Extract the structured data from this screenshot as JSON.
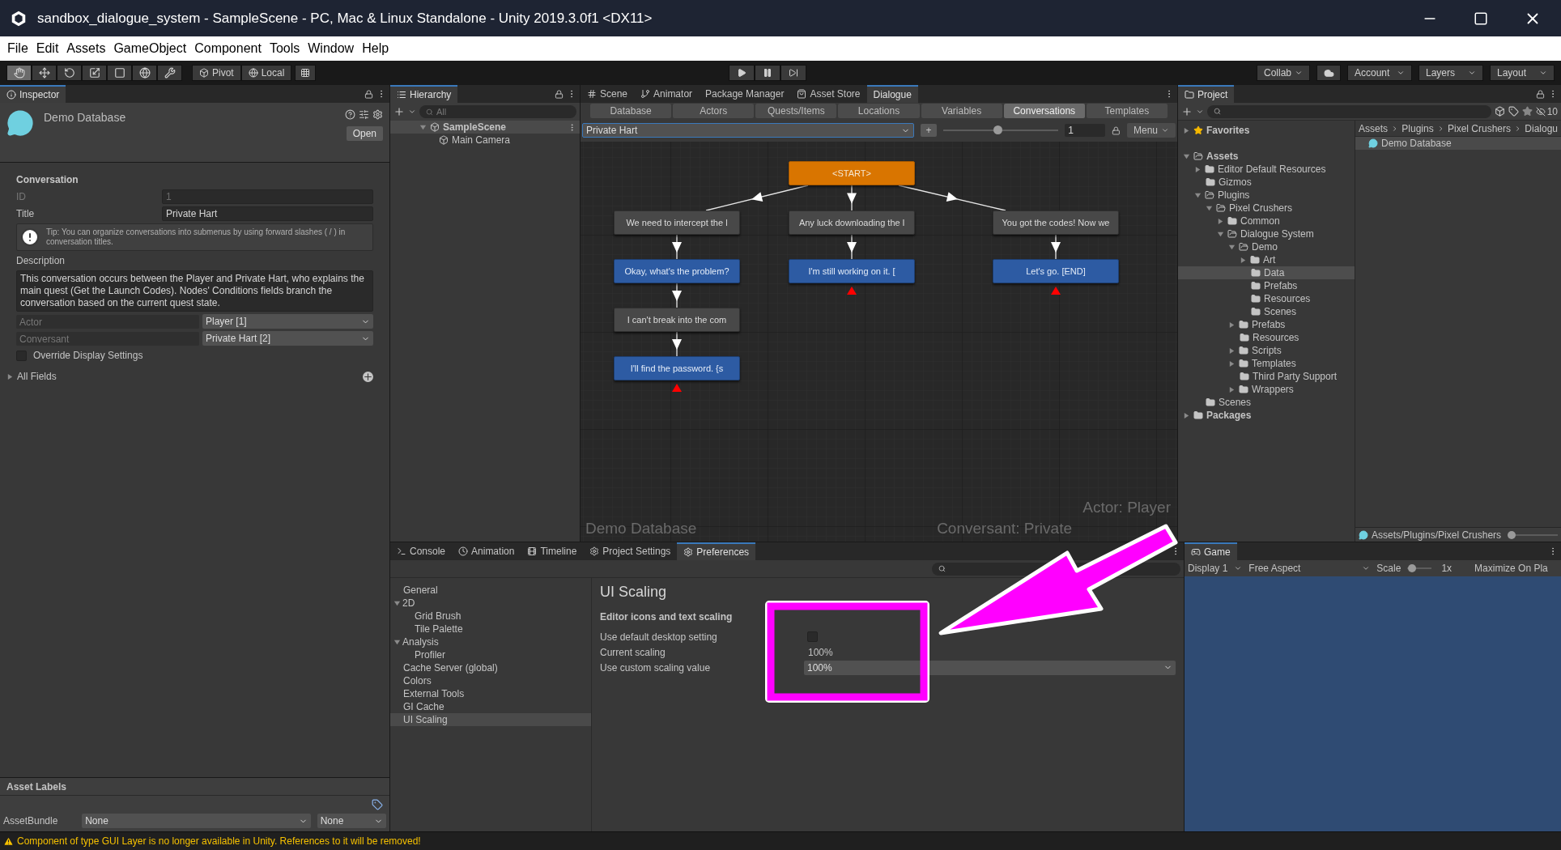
{
  "window": {
    "title": "sandbox_dialogue_system - SampleScene - PC, Mac & Linux Standalone - Unity 2019.3.0f1 <DX11>"
  },
  "menu": [
    "File",
    "Edit",
    "Assets",
    "GameObject",
    "Component",
    "Tools",
    "Window",
    "Help"
  ],
  "toolbar": {
    "tools": [
      {
        "kind": "hand",
        "selected": true
      },
      {
        "kind": "move",
        "selected": false
      },
      {
        "kind": "rotate",
        "selected": false
      },
      {
        "kind": "scale",
        "selected": false
      },
      {
        "kind": "rect",
        "selected": false
      },
      {
        "kind": "transform",
        "selected": false
      },
      {
        "kind": "custom",
        "selected": false
      }
    ],
    "pivot": "Pivot",
    "space": "Local",
    "collab": "Collab",
    "account": "Account",
    "layers": "Layers",
    "layout": "Layout"
  },
  "inspector": {
    "tab": "Inspector",
    "object": "Demo Database",
    "open_button": "Open",
    "section": "Conversation",
    "fields": [
      {
        "label": "ID",
        "value": "1",
        "disabled": true
      },
      {
        "label": "Title",
        "value": "Private Hart",
        "disabled": false
      }
    ],
    "tip": "Tip: You can organize conversations into submenus by using forward slashes ( / ) in conversation titles.",
    "description_label": "Description",
    "description": "This conversation occurs between the Player and Private Hart, who explains the main quest (Get the Launch Codes). Nodes' Conditions fields branch the conversation based on the current quest state.",
    "popups": [
      {
        "label": "Actor",
        "value": "Player [1]"
      },
      {
        "label": "Conversant",
        "value": "Private Hart [2]"
      }
    ],
    "override": {
      "label": "Override Display Settings",
      "checked": false
    },
    "all_fields": {
      "label": "All Fields",
      "expanded": false
    },
    "asset_labels": "Asset Labels",
    "asset_bundle": {
      "label": "AssetBundle",
      "value": "None",
      "variant": "None"
    }
  },
  "hierarchy": {
    "tab": "Hierarchy",
    "search": {
      "placeholder": "All"
    },
    "items": [
      {
        "label": "SampleScene",
        "kind": "scene",
        "expanded": true,
        "selected": true,
        "children": [
          {
            "label": "Main Camera",
            "kind": "object",
            "selected": false
          }
        ]
      }
    ]
  },
  "dialogue": {
    "tabs": [
      {
        "label": "Scene",
        "selected": false
      },
      {
        "label": "Animator",
        "selected": false
      },
      {
        "label": "Package Manager",
        "selected": false
      },
      {
        "label": "Asset Store",
        "selected": false
      },
      {
        "label": "Dialogue",
        "selected": true
      }
    ],
    "subtabs": [
      {
        "label": "Database",
        "selected": false
      },
      {
        "label": "Actors",
        "selected": false
      },
      {
        "label": "Quests/Items",
        "selected": false
      },
      {
        "label": "Locations",
        "selected": false
      },
      {
        "label": "Variables",
        "selected": false
      },
      {
        "label": "Conversations",
        "selected": true
      },
      {
        "label": "Templates",
        "selected": false
      }
    ],
    "conversation": "Private Hart",
    "add_button": "+",
    "zoom": {
      "level": 0.47
    },
    "zoom_value": "1",
    "menu_button": "Menu",
    "nodes": [
      {
        "kind": "start",
        "text": "<START>",
        "dead_end": false
      },
      {
        "kind": "npc",
        "text": "We need to intercept the l",
        "dead_end": false
      },
      {
        "kind": "npc",
        "text": "Any luck downloading the l",
        "dead_end": false
      },
      {
        "kind": "npc",
        "text": "You got the codes! Now we",
        "dead_end": false
      },
      {
        "kind": "player",
        "text": "Okay, what's the problem?",
        "dead_end": false
      },
      {
        "kind": "player",
        "text": "I'm still working on it. [",
        "dead_end": true
      },
      {
        "kind": "player",
        "text": "Let's go. [END]",
        "dead_end": true
      },
      {
        "kind": "npc",
        "text": "I can't break into the com",
        "dead_end": false
      },
      {
        "kind": "player",
        "text": "I'll find the password. {s",
        "dead_end": true
      }
    ],
    "watermark": {
      "database": "Demo Database",
      "actor": "Actor: Player",
      "conversant": "Conversant: Private"
    }
  },
  "project": {
    "tab": "Project",
    "hidden_count": "10",
    "tree": [
      {
        "label": "Favorites",
        "kind": "favorites",
        "expanded": false,
        "selected": false
      },
      {
        "label": "Assets",
        "kind": "root",
        "expanded": true,
        "selected": false,
        "children": [
          {
            "label": "Editor Default Resources",
            "kind": "folder",
            "expanded": false,
            "selected": false
          },
          {
            "label": "Gizmos",
            "kind": "folder",
            "selected": false
          },
          {
            "label": "Plugins",
            "kind": "folder",
            "expanded": true,
            "selected": false,
            "children": [
              {
                "label": "Pixel Crushers",
                "kind": "folder",
                "expanded": true,
                "selected": false,
                "children": [
                  {
                    "label": "Common",
                    "kind": "folder",
                    "expanded": false,
                    "selected": false
                  },
                  {
                    "label": "Dialogue System",
                    "kind": "folder",
                    "expanded": true,
                    "selected": false,
                    "children": [
                      {
                        "label": "Demo",
                        "kind": "folder",
                        "expanded": true,
                        "selected": false,
                        "children": [
                          {
                            "label": "Art",
                            "kind": "folder",
                            "expanded": false,
                            "selected": false
                          },
                          {
                            "label": "Data",
                            "kind": "folder",
                            "selected": true
                          },
                          {
                            "label": "Prefabs",
                            "kind": "folder",
                            "selected": false
                          },
                          {
                            "label": "Resources",
                            "kind": "folder",
                            "selected": false
                          },
                          {
                            "label": "Scenes",
                            "kind": "folder",
                            "selected": false
                          }
                        ]
                      },
                      {
                        "label": "Prefabs",
                        "kind": "folder",
                        "expanded": false,
                        "selected": false
                      },
                      {
                        "label": "Resources",
                        "kind": "folder",
                        "selected": false
                      },
                      {
                        "label": "Scripts",
                        "kind": "folder",
                        "expanded": false,
                        "selected": false
                      },
                      {
                        "label": "Templates",
                        "kind": "folder",
                        "expanded": false,
                        "selected": false
                      },
                      {
                        "label": "Third Party Support",
                        "kind": "folder",
                        "selected": false
                      },
                      {
                        "label": "Wrappers",
                        "kind": "folder",
                        "expanded": false,
                        "selected": false
                      }
                    ]
                  }
                ]
              }
            ]
          },
          {
            "label": "Scenes",
            "kind": "folder",
            "selected": false
          }
        ]
      },
      {
        "label": "Packages",
        "kind": "root",
        "expanded": false,
        "selected": false
      }
    ],
    "breadcrumb": [
      "Assets",
      "Plugins",
      "Pixel Crushers",
      "Dialogu"
    ],
    "files": [
      {
        "label": "Demo Database",
        "selected": true
      }
    ],
    "path": "Assets/Plugins/Pixel Crushers",
    "icon_size": {
      "level": 0
    }
  },
  "preferences": {
    "tabs": [
      {
        "label": "Console",
        "selected": false
      },
      {
        "label": "Animation",
        "selected": false
      },
      {
        "label": "Timeline",
        "selected": false
      },
      {
        "label": "Project Settings",
        "selected": false
      },
      {
        "label": "Preferences",
        "selected": true
      }
    ],
    "sections": [
      {
        "label": "General",
        "selected": false
      },
      {
        "label": "2D",
        "expanded": true,
        "selected": false,
        "children": [
          {
            "label": "Grid Brush",
            "selected": false
          },
          {
            "label": "Tile Palette",
            "selected": false
          }
        ]
      },
      {
        "label": "Analysis",
        "expanded": true,
        "selected": false,
        "children": [
          {
            "label": "Profiler",
            "selected": false
          }
        ]
      },
      {
        "label": "Cache Server (global)",
        "selected": false
      },
      {
        "label": "Colors",
        "selected": false
      },
      {
        "label": "External Tools",
        "selected": false
      },
      {
        "label": "GI Cache",
        "selected": false
      },
      {
        "label": "UI Scaling",
        "selected": true
      }
    ],
    "page": {
      "title": "UI Scaling",
      "subtitle": "Editor icons and text scaling",
      "rows": [
        {
          "kind": "checkbox",
          "label": "Use default desktop setting",
          "checked": false
        },
        {
          "kind": "text",
          "label": "Current scaling",
          "value": "100%"
        },
        {
          "kind": "dropdown",
          "label": "Use custom scaling value",
          "value": "100%"
        }
      ]
    }
  },
  "game": {
    "tab": "Game",
    "display": "Display 1",
    "aspect": "Free Aspect",
    "scale_label": "Scale",
    "scale": {
      "level": 0.1
    },
    "scale_value": "1x",
    "maximize": "Maximize On Pla"
  },
  "status": {
    "kind": "warning",
    "message": "Component of type GUI Layer is no longer available in Unity. References to it will be removed!"
  }
}
